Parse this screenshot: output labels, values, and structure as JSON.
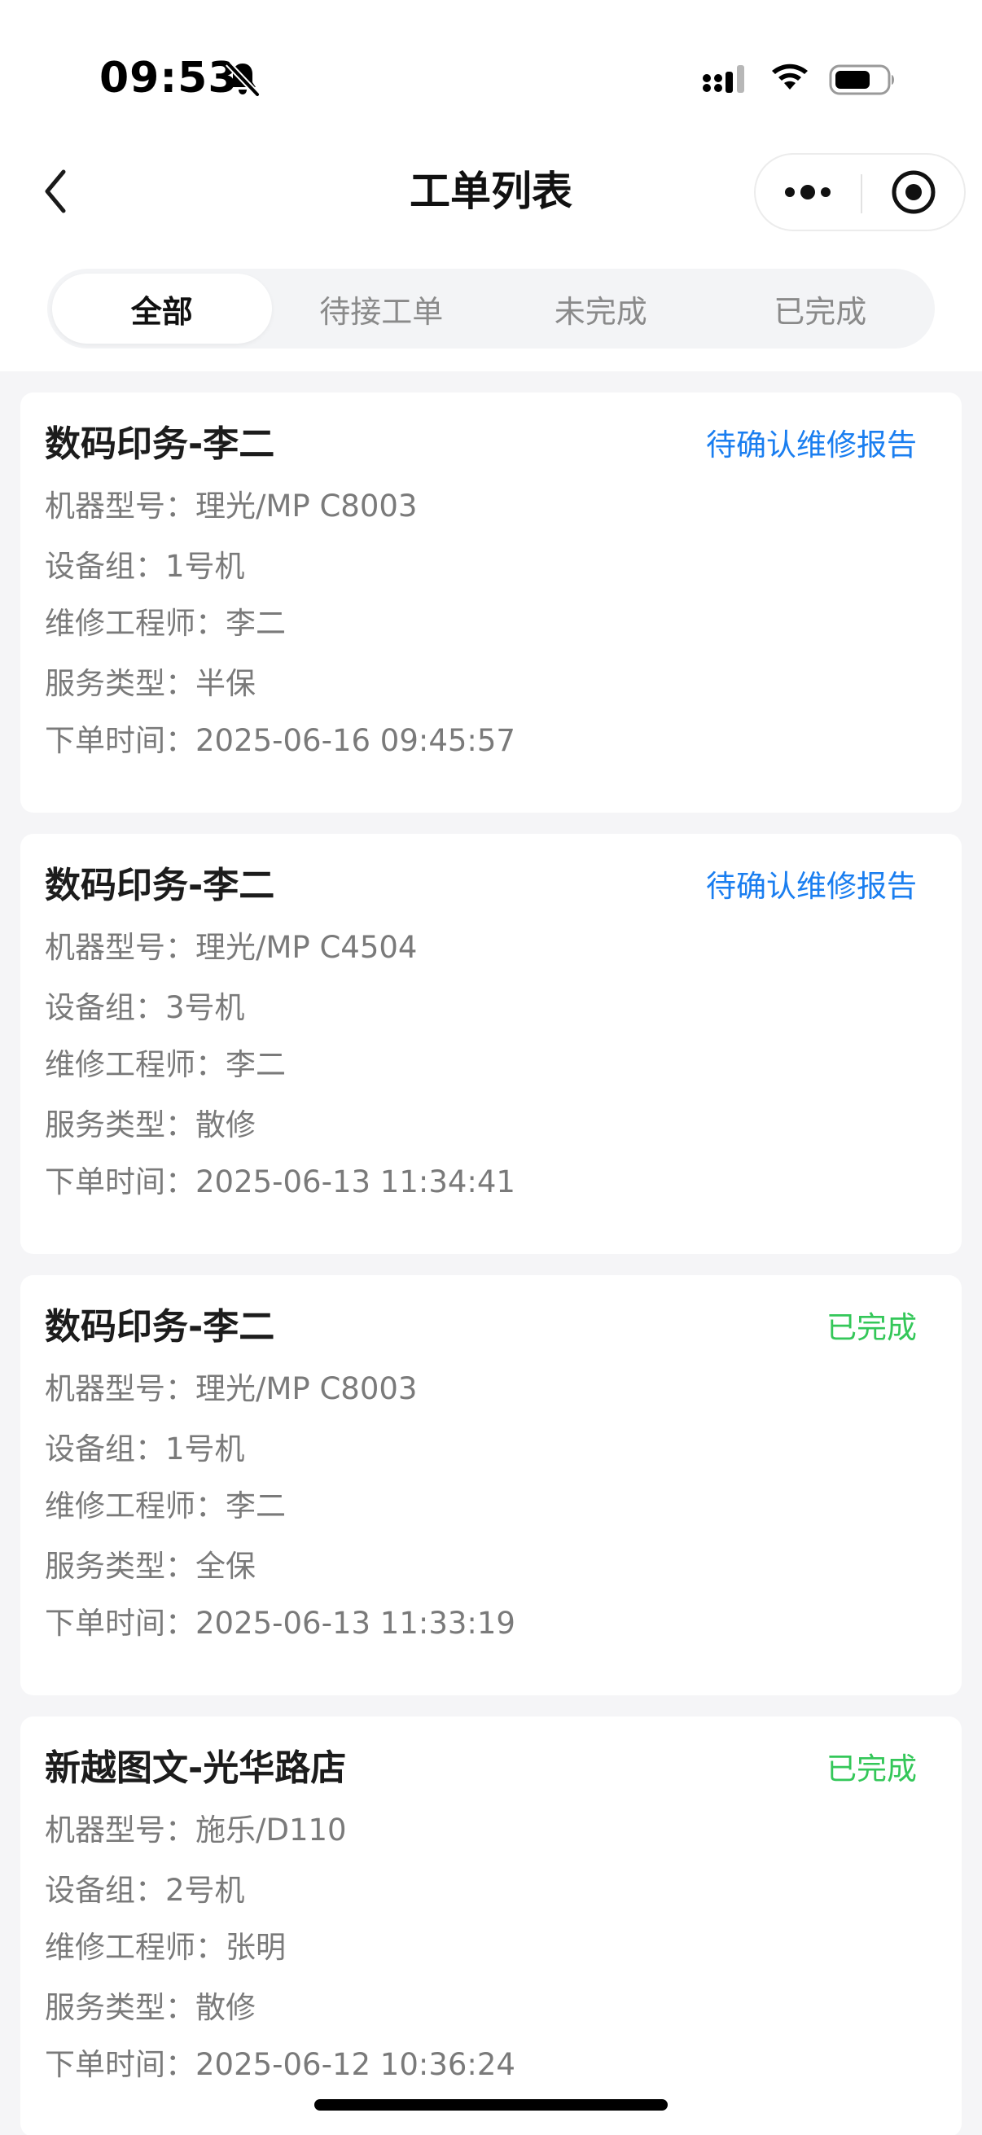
{
  "status_bar": {
    "time": "09:53",
    "mute_icon": "bell-slash-icon",
    "signal_icon": "cellular-signal-icon",
    "wifi_icon": "wifi-icon",
    "battery_icon": "battery-icon"
  },
  "nav": {
    "title": "工单列表",
    "back_icon": "chevron-left-icon",
    "more_icon": "more-dots-icon",
    "close_icon": "target-circle-icon"
  },
  "tabs": [
    {
      "label": "全部",
      "active": true
    },
    {
      "label": "待接工单",
      "active": false
    },
    {
      "label": "未完成",
      "active": false
    },
    {
      "label": "已完成",
      "active": false
    }
  ],
  "colors": {
    "status_pending": "#1a7ef0",
    "status_done": "#34c759",
    "page_bg": "#f5f5f7"
  },
  "orders": [
    {
      "title": "数码印务-李二",
      "status": "待确认维修报告",
      "status_color": "#1a7ef0",
      "model": "机器型号：理光/MP C8003",
      "group": "设备组：1号机",
      "engineer": "维修工程师：李二",
      "service": "服务类型：半保",
      "time": "下单时间：2025-06-16 09:45:57"
    },
    {
      "title": "数码印务-李二",
      "status": "待确认维修报告",
      "status_color": "#1a7ef0",
      "model": "机器型号：理光/MP C4504",
      "group": "设备组：3号机",
      "engineer": "维修工程师：李二",
      "service": "服务类型：散修",
      "time": "下单时间：2025-06-13 11:34:41"
    },
    {
      "title": "数码印务-李二",
      "status": "已完成",
      "status_color": "#34c759",
      "model": "机器型号：理光/MP C8003",
      "group": "设备组：1号机",
      "engineer": "维修工程师：李二",
      "service": "服务类型：全保",
      "time": "下单时间：2025-06-13 11:33:19"
    },
    {
      "title": "新越图文-光华路店",
      "status": "已完成",
      "status_color": "#34c759",
      "model": "机器型号：施乐/D110",
      "group": "设备组：2号机",
      "engineer": "维修工程师：张明",
      "service": "服务类型：散修",
      "time": "下单时间：2025-06-12 10:36:24"
    }
  ]
}
